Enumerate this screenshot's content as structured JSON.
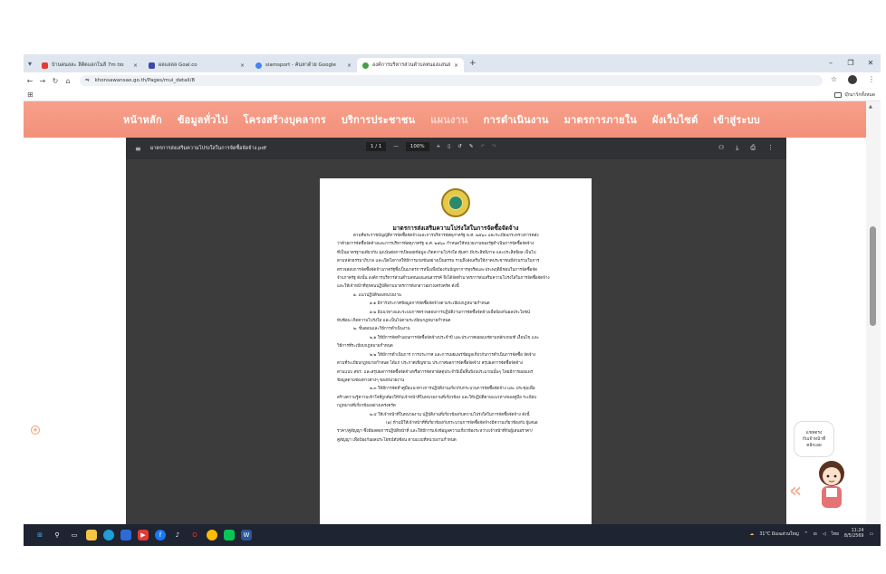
{
  "browser": {
    "tabs": [
      {
        "title": "บ้านคนลละ ลิดิตแลกโนลี 7m tio",
        "fav_color": "#e53935",
        "active": false
      },
      {
        "title": "ผลแลลล Goal.co",
        "fav_color": "#3949ab",
        "active": false
      },
      {
        "title": "siamsport - ค้นหาด้วย Google",
        "fav_color": "#4285f4",
        "active": false
      },
      {
        "title": "องค์การบริหารส่วนตำบลหนองแสนสวรรค์",
        "fav_color": "#43a047",
        "active": true
      }
    ],
    "new_tab": "+",
    "url": "khonsawansao.go.th/Pages/mui_detail/8",
    "all_bookmarks": "บุ๊กมาร์กทั้งหมด"
  },
  "site": {
    "nav": [
      "หน้าหลัก",
      "ข้อมูลทั่วไป",
      "โครงสร้างบุคลากร",
      "บริการประชาชน",
      "แผนงาน",
      "การดำเนินงาน",
      "มาตรการภายใน",
      "ผังเว็บไซต์",
      "เข้าสู่ระบบ"
    ]
  },
  "pdf": {
    "filename": "มาตรการส่งเสริมความโปร่งใสในการจัดซื้อจัดจ้าง.pdf",
    "page": "1 / 1",
    "zoom": "100%",
    "doc_title": "มาตรการส่งเสริมความโปร่งใสในการจัดซื้อจัดจ้าง",
    "lines": [
      "ตามที่พระราชบัญญัติการจัดซื้อจัดจ้างและการบริหารพัสดุภาครัฐ พ.ศ. ๒๕๖๐ และระเบียบกระทรวงการคลัง",
      "ว่าด้วยการจัดซื้อจัดจ้างและการบริหารพัสดุภาครัฐ พ.ศ. ๒๕๖๐ กำหนดให้หน่วยงานของรัฐดำเนินการจัดซื้อจัดจ้าง",
      "ที่เป็นมาตรฐานเดียวกัน มุ่งเน้นต่อการเปิดเผยข้อมูล เกิดความโปร่งใส คุ้มค่า มีประสิทธิภาพ และประสิทธิผล เป็นไป",
      "ตามหลักธรรมาภิบาล และเปิดโอกาสให้มีการแข่งขันอย่างเป็นธรรม รวมถึงส่งเสริมให้ภาคประชาชนมีส่วนร่วมในการ",
      "ตรวจสอบการจัดซื้อจัดจ้างภาครัฐซึ่งเป็นมาตรการหนึ่งเพื่อป้องกันปัญหาการทุจริตและประพฤติมิชอบในการจัดซื้อจัด",
      "จ้างภาครัฐ ดังนั้น องค์การบริหารส่วนตำบลหนองแสนสวรรค์ จึงได้จัดทำมาตรการส่งเสริมความโปร่งใสในการจัดซื้อจัดจ้าง",
      "และให้เจ้าหน้าที่ทุกคนปฏิบัติตามมาตรการดังกล่าวอย่างเคร่งครัด ดังนี้",
      "๑. แนวปฏิบัติของหน่วยงาน",
      "๑.๑ มีการประกาศข้อมูลการจัดซื้อจัดจ้างตามระเบียบกฎหมายกำหนด",
      "๑.๒ มีแนวทางและระบบการตรวจสอบการปฏิบัติงานการจัดซื้อจัดจ้างเพื่อป้องกันผลประโยชน์",
      "ทับซ้อน เกิดความโปร่งใส และเป็นไปตามระเบียบกฎหมายกำหนด",
      "๒. ขั้นตอนและวิธีการดำเนินงาน",
      "๒.๑ ให้มีการจัดทำแผนการจัดซื้อจัดจ้างประจำปี และประกาศเผยแพร่ตามหลักเกณฑ์ เงื่อนไข และ",
      "วิธีการที่ระเบียบกฎหมายกำหนด",
      "๒.๒ ให้มีการดำเนินการ การประกาศ และการเผยแพร่ข้อมูลเกี่ยวกับการดำเนินการจัดซื้อ จัดจ้าง",
      "ตามที่ระเบียบกฎหมายกำหนด ได้แก่ ประกาศเชิญชวน ประกาศผลการจัดซื้อจัดจ้าง สรุปผลการจัดซื้อจัดจ้าง",
      "ตามแบบ สขร. และสรุปผลการจัดซื้อจัดจ้างหรือการจัดหาพัสดุประจำปีเมื่อสิ้นปีงบประมาณนั้นๆ โดยมีการเผยแพร่",
      "ข้อมูลตามช่องทางต่างๆ ของหน่วยงาน",
      "๒.๓ ให้มีการจัดทำคู่มือแนวทางการปฏิบัติงานเกี่ยวกับกระบวนการจัดซื้อจัดจ้าง และ ประชุมเพื่อ",
      "สร้างความรู้ความเข้าใจที่ถูกต้องให้กับเจ้าหน้าที่ในหน่วยงานที่เกี่ยวข้อง และให้ปฏิบัติตามแนวทางของคู่มือ ระเบียบ",
      "กฎหมายที่เกี่ยวข้องอย่างเคร่งครัด",
      "๒.๔ ให้เจ้าหน้าที่ในหน่วยงาน ปฏิบัติงานที่เกี่ยวข้องกับความโปร่งใสในการจัดซื้อจัดจ้าง ดังนี้",
      "(๑) ห้ามมิให้เจ้าหน้าที่ที่เกี่ยวข้องกับกระบวนการจัดซื้อจัดจ้างมีความเกี่ยวข้องกับ ผู้เสนอ",
      "ราคา/คู่สัญญา ซึ่งมีผลต่อการปฏิบัติหน้าที่ และให้มีการแจ้งข้อมูลความเกี่ยวข้องระหว่างเจ้าหน้าที่กับผู้เสนอราคา/",
      "คู่สัญญา เพื่อป้องกันผลประโยชน์ทับซ้อน ตามแบบที่หน่วยงานกำหนด"
    ]
  },
  "chat": {
    "line1": "แชทตรง",
    "line2": "กับเจ้าหน้าที่",
    "line3": "คลิกเลย"
  },
  "taskbar": {
    "weather": "31°C มีเมฆส่วนใหญ่",
    "time": "11:24",
    "date": "8/5/2569",
    "lang": "ไทย"
  }
}
